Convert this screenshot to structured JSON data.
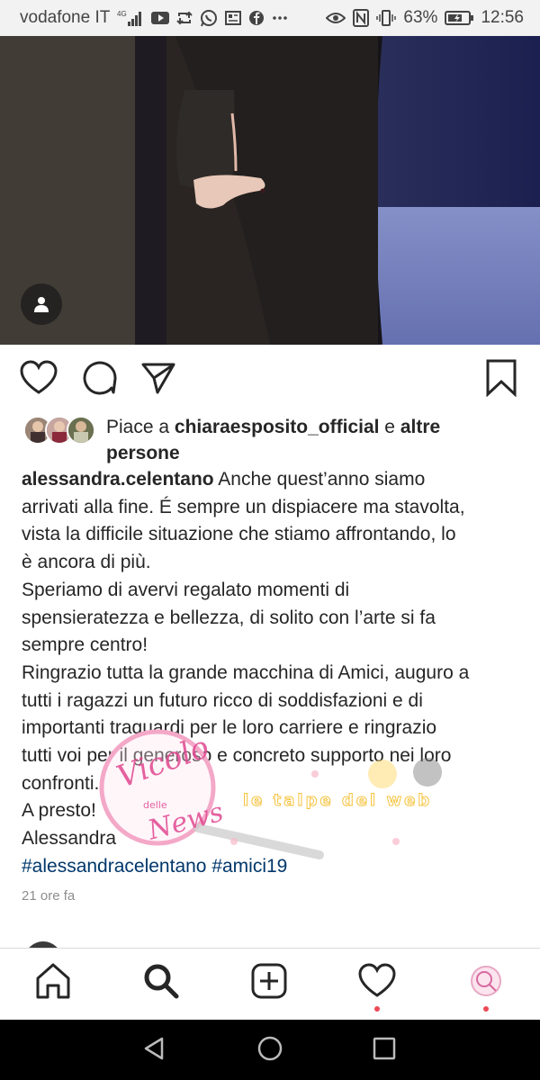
{
  "status_bar": {
    "carrier": "vodafone IT",
    "network": "4G",
    "battery_percent": "63%",
    "time": "12:56",
    "icons": [
      "youtube-icon",
      "retweet-icon",
      "whatsapp-icon",
      "news-icon",
      "facebook-icon",
      "more-icon",
      "eye-icon",
      "nfc-icon",
      "vibrate-icon",
      "battery-icon"
    ]
  },
  "post": {
    "likes": {
      "prefix": "Piace a ",
      "user": "chiaraesposito_official",
      "middle": " e ",
      "others": "altre",
      "others2": "persone"
    },
    "caption": {
      "username": "alessandra.celentano",
      "lines": [
        " Anche quest’anno siamo",
        "arrivati alla fine. É sempre un dispiacere ma stavolta,",
        "vista la difficile situazione che stiamo affrontando, lo",
        "è ancora di più.",
        "Speriamo di avervi regalato momenti di",
        "spensieratezza e bellezza, di solito con l’arte si fa",
        "sempre centro!",
        "Ringrazio tutta la grande macchina di Amici, auguro a",
        "tutti i ragazzi un futuro ricco di soddisfazioni e di",
        "importanti traguardi per le loro carriere e ringrazio",
        "tutti voi per il generoso e concreto supporto nei loro",
        "confronti.",
        "A presto!",
        "Alessandra"
      ],
      "hashtags": "#alessandracelentano #amici19"
    },
    "timestamp": "21 ore fa"
  },
  "watermark": {
    "text_main": "Vicolo",
    "text_small": "delle",
    "text_news": "News",
    "text_web": "le talpe del web"
  },
  "colors": {
    "hashtag": "#00376b",
    "notification_dot": "#ed4956",
    "secondary_text": "#8e8e8e"
  }
}
